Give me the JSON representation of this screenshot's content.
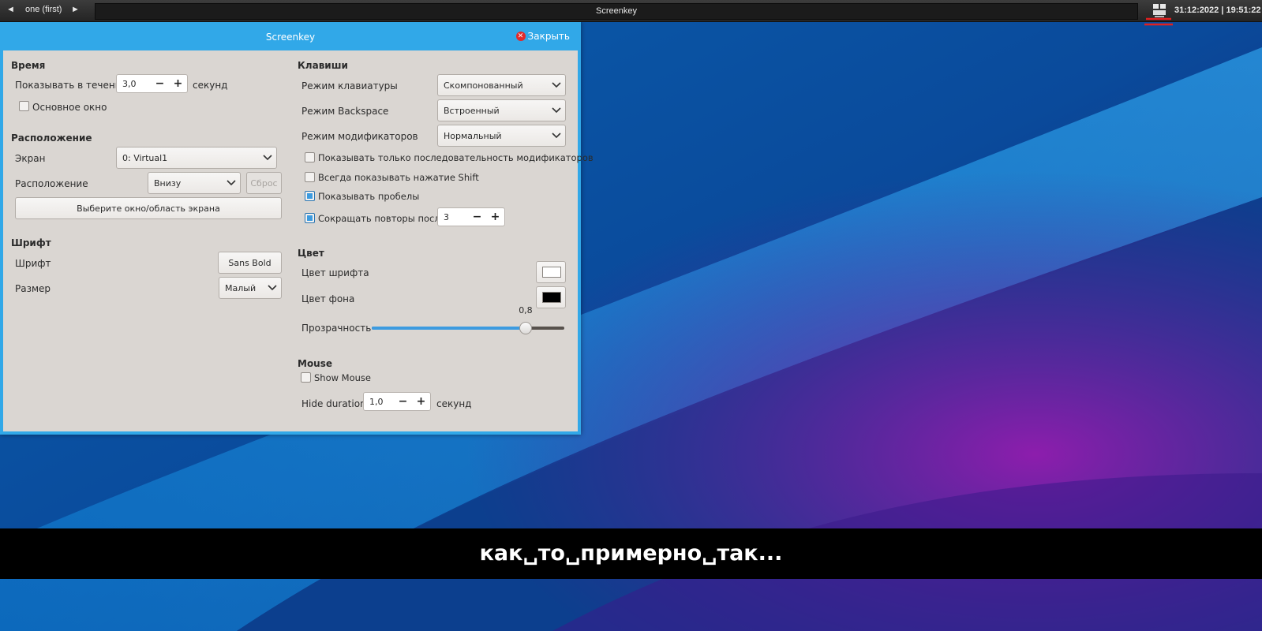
{
  "panel": {
    "prev_icon": "triangle-left-icon",
    "prev": "◄",
    "workspace_label": "one (first)",
    "next_icon": "triangle-right-icon",
    "next": "►",
    "taskbar_title": "Screenkey",
    "tray_icon": "network-computer-icon",
    "clock": "31:12:2022 | 19:51:22",
    "annotation_color": "#e02020"
  },
  "window": {
    "title": "Screenkey",
    "close_label": "Закрыть",
    "close_icon": "close-circle-icon",
    "accent_color": "#31a8e8",
    "bg_color": "#dad6d2"
  },
  "left": {
    "time": {
      "heading": "Время",
      "show_for_label": "Показывать в течение",
      "show_for_value": "3,0",
      "show_for_unit": "секунд",
      "minus": "−",
      "plus": "+",
      "main_window_label": "Основное окно",
      "main_window_checked": false
    },
    "position": {
      "heading": "Расположение",
      "screen_label": "Экран",
      "screen_value": "0: Virtual1",
      "position_label": "Расположение",
      "position_value": "Внизу",
      "reset_label": "Сброс",
      "select_area_label": "Выберите окно/область экрана"
    },
    "font": {
      "heading": "Шрифт",
      "font_label": "Шрифт",
      "font_value": "Sans Bold",
      "size_label": "Размер",
      "size_value": "Малый"
    }
  },
  "right": {
    "keys": {
      "heading": "Клавиши",
      "keyboard_mode_label": "Режим клавиатуры",
      "keyboard_mode_value": "Скомпонованный",
      "backspace_mode_label": "Режим Backspace",
      "backspace_mode_value": "Встроенный",
      "modifiers_mode_label": "Режим модификаторов",
      "modifiers_mode_value": "Нормальный",
      "mods_only_label": "Показывать только последовательность модификаторов",
      "mods_only_checked": false,
      "always_shift_label": "Всегда показывать нажатие Shift",
      "always_shift_checked": false,
      "show_spaces_label": "Показывать пробелы",
      "show_spaces_checked": true,
      "compress_label": "Сокращать повторы после",
      "compress_checked": true,
      "compress_value": "3",
      "minus": "−",
      "plus": "+"
    },
    "color": {
      "heading": "Цвет",
      "font_color_label": "Цвет шрифта",
      "font_color": "#ffffff",
      "bg_color_label": "Цвет фона",
      "bg_color": "#000000",
      "opacity_label": "Прозрачность",
      "opacity_value": "0,8",
      "opacity": 0.8
    },
    "mouse": {
      "heading": "Mouse",
      "show_mouse_label": "Show Mouse",
      "show_mouse_checked": false,
      "hide_duration_label": "Hide duration",
      "hide_duration_value": "1,0",
      "hide_duration_unit": "секунд",
      "minus": "−",
      "plus": "+"
    }
  },
  "overlay": {
    "text": "как␣то␣примерно␣так..."
  }
}
